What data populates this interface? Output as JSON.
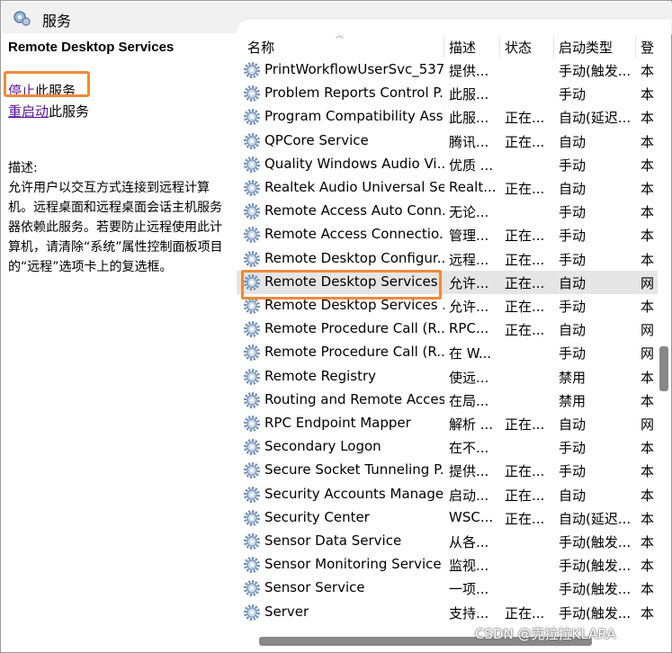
{
  "window": {
    "title": "服务"
  },
  "left_panel": {
    "service_name": "Remote Desktop Services",
    "stop_link": "停止",
    "stop_suffix": "此服务",
    "restart_link": "重启动",
    "restart_suffix": "此服务",
    "description_label": "描述:",
    "description": "允许用户以交互方式连接到远程计算机。远程桌面和远程桌面会话主机服务器依赖此服务。若要防止远程使用此计算机，请清除“系统”属性控制面板项目的“远程”选项卡上的复选框。"
  },
  "table": {
    "headers": {
      "name": "名称",
      "description": "描述",
      "status": "状态",
      "startup": "启动类型",
      "logon": "登"
    },
    "rows": [
      {
        "name": "PrintWorkflowUserSvc_537...",
        "description": "提供...",
        "status": "",
        "startup": "手动(触发...",
        "logon": "本"
      },
      {
        "name": "Problem Reports Control P...",
        "description": "此服...",
        "status": "",
        "startup": "手动",
        "logon": "本"
      },
      {
        "name": "Program Compatibility Assi...",
        "description": "此服...",
        "status": "正在...",
        "startup": "自动(延迟...",
        "logon": "本"
      },
      {
        "name": "QPCore Service",
        "description": "腾讯...",
        "status": "正在...",
        "startup": "自动",
        "logon": "本"
      },
      {
        "name": "Quality Windows Audio Vi...",
        "description": "优质 ...",
        "status": "",
        "startup": "手动",
        "logon": "本"
      },
      {
        "name": "Realtek Audio Universal Se...",
        "description": "Realt...",
        "status": "正在...",
        "startup": "自动",
        "logon": "本"
      },
      {
        "name": "Remote Access Auto Conn...",
        "description": "无论...",
        "status": "",
        "startup": "手动",
        "logon": "本"
      },
      {
        "name": "Remote Access Connectio...",
        "description": "管理...",
        "status": "正在...",
        "startup": "手动",
        "logon": "本"
      },
      {
        "name": "Remote Desktop Configur...",
        "description": "远程...",
        "status": "正在...",
        "startup": "手动",
        "logon": "本"
      },
      {
        "name": "Remote Desktop Services",
        "description": "允许...",
        "status": "正在...",
        "startup": "自动",
        "logon": "网"
      },
      {
        "name": "Remote Desktop Services ...",
        "description": "允许...",
        "status": "正在...",
        "startup": "手动",
        "logon": "本"
      },
      {
        "name": "Remote Procedure Call (R...",
        "description": "RPC...",
        "status": "正在...",
        "startup": "自动",
        "logon": "网"
      },
      {
        "name": "Remote Procedure Call (R...",
        "description": "在 W...",
        "status": "",
        "startup": "手动",
        "logon": "网"
      },
      {
        "name": "Remote Registry",
        "description": "使远...",
        "status": "",
        "startup": "禁用",
        "logon": "本"
      },
      {
        "name": "Routing and Remote Access",
        "description": "在局...",
        "status": "",
        "startup": "禁用",
        "logon": "本"
      },
      {
        "name": "RPC Endpoint Mapper",
        "description": "解析 ...",
        "status": "正在...",
        "startup": "自动",
        "logon": "网"
      },
      {
        "name": "Secondary Logon",
        "description": "在不...",
        "status": "",
        "startup": "手动",
        "logon": "本"
      },
      {
        "name": "Secure Socket Tunneling P...",
        "description": "提供...",
        "status": "正在...",
        "startup": "手动",
        "logon": "本"
      },
      {
        "name": "Security Accounts Manager",
        "description": "启动...",
        "status": "正在...",
        "startup": "自动",
        "logon": "本"
      },
      {
        "name": "Security Center",
        "description": "WSC...",
        "status": "正在...",
        "startup": "自动(延迟...",
        "logon": "本"
      },
      {
        "name": "Sensor Data Service",
        "description": "从各...",
        "status": "",
        "startup": "手动(触发...",
        "logon": "本"
      },
      {
        "name": "Sensor Monitoring Service",
        "description": "监视...",
        "status": "",
        "startup": "手动(触发...",
        "logon": "本"
      },
      {
        "name": "Sensor Service",
        "description": "一项...",
        "status": "",
        "startup": "手动(触发...",
        "logon": "本"
      },
      {
        "name": "Server",
        "description": "支持...",
        "status": "正在...",
        "startup": "手动(触发...",
        "logon": "本"
      }
    ],
    "selected_index": 9
  },
  "watermark": "CSDN @克拉拉KLARA",
  "colors": {
    "highlight_box": "#f08a3a",
    "link": "#5a0fa0",
    "selected_row": "#e5e5e5"
  }
}
